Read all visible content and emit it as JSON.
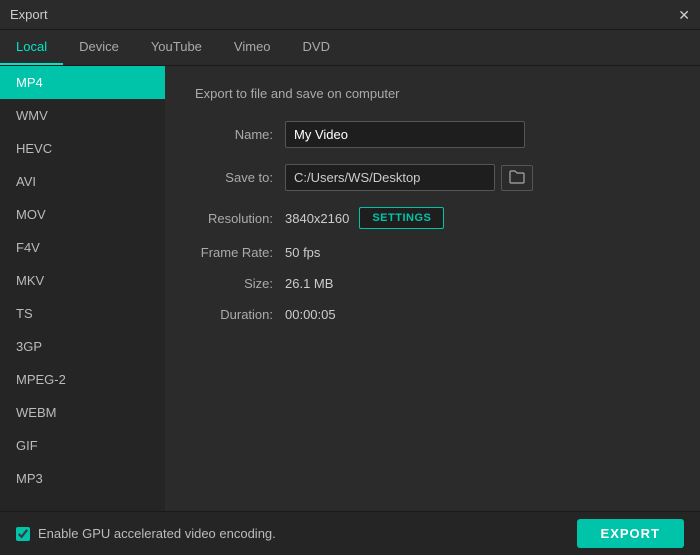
{
  "titleBar": {
    "title": "Export",
    "closeLabel": "✕"
  },
  "tabs": [
    {
      "id": "local",
      "label": "Local",
      "active": true
    },
    {
      "id": "device",
      "label": "Device",
      "active": false
    },
    {
      "id": "youtube",
      "label": "YouTube",
      "active": false
    },
    {
      "id": "vimeo",
      "label": "Vimeo",
      "active": false
    },
    {
      "id": "dvd",
      "label": "DVD",
      "active": false
    }
  ],
  "sidebar": {
    "items": [
      {
        "id": "mp4",
        "label": "MP4",
        "active": true
      },
      {
        "id": "wmv",
        "label": "WMV",
        "active": false
      },
      {
        "id": "hevc",
        "label": "HEVC",
        "active": false
      },
      {
        "id": "avi",
        "label": "AVI",
        "active": false
      },
      {
        "id": "mov",
        "label": "MOV",
        "active": false
      },
      {
        "id": "f4v",
        "label": "F4V",
        "active": false
      },
      {
        "id": "mkv",
        "label": "MKV",
        "active": false
      },
      {
        "id": "ts",
        "label": "TS",
        "active": false
      },
      {
        "id": "3gp",
        "label": "3GP",
        "active": false
      },
      {
        "id": "mpeg2",
        "label": "MPEG-2",
        "active": false
      },
      {
        "id": "webm",
        "label": "WEBM",
        "active": false
      },
      {
        "id": "gif",
        "label": "GIF",
        "active": false
      },
      {
        "id": "mp3",
        "label": "MP3",
        "active": false
      }
    ]
  },
  "content": {
    "title": "Export to file and save on computer",
    "nameLabel": "Name:",
    "nameValue": "My Video",
    "saveToLabel": "Save to:",
    "saveToPath": "C:/Users/WS/Desktop",
    "folderIcon": "📁",
    "resolutionLabel": "Resolution:",
    "resolutionValue": "3840x2160",
    "settingsLabel": "SETTINGS",
    "frameRateLabel": "Frame Rate:",
    "frameRateValue": "50 fps",
    "sizeLabel": "Size:",
    "sizeValue": "26.1 MB",
    "durationLabel": "Duration:",
    "durationValue": "00:00:05"
  },
  "bottomBar": {
    "gpuLabel": "Enable GPU accelerated video encoding.",
    "gpuChecked": true,
    "exportLabel": "EXPORT"
  }
}
